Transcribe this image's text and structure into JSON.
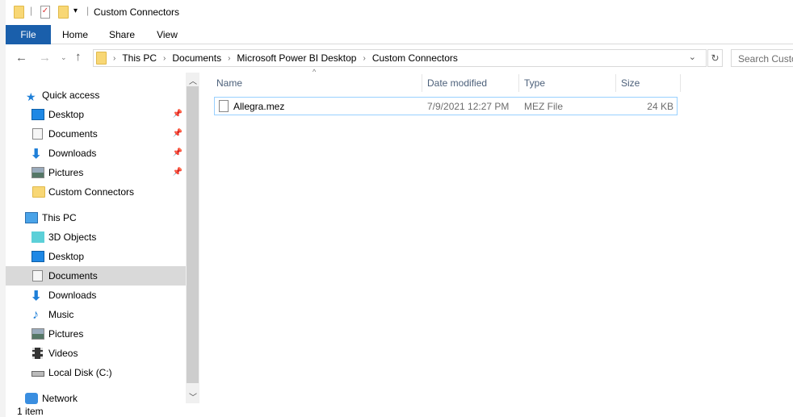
{
  "window": {
    "title": "Custom Connectors"
  },
  "ribbon": {
    "tabs": [
      "File",
      "Home",
      "Share",
      "View"
    ]
  },
  "address": {
    "crumbs": [
      "This PC",
      "Documents",
      "Microsoft Power BI Desktop",
      "Custom Connectors"
    ],
    "search_placeholder": "Search Custom Connectors"
  },
  "nav": {
    "quick_access": "Quick access",
    "quick_items": [
      {
        "label": "Desktop",
        "icon": "desktop-icon",
        "pinned": true
      },
      {
        "label": "Documents",
        "icon": "documents-icon",
        "pinned": true
      },
      {
        "label": "Downloads",
        "icon": "downloads-icon",
        "pinned": true
      },
      {
        "label": "Pictures",
        "icon": "pictures-icon",
        "pinned": true
      },
      {
        "label": "Custom Connectors",
        "icon": "folder-icon",
        "pinned": false
      }
    ],
    "this_pc": "This PC",
    "pc_items": [
      {
        "label": "3D Objects"
      },
      {
        "label": "Desktop"
      },
      {
        "label": "Documents",
        "selected": true
      },
      {
        "label": "Downloads"
      },
      {
        "label": "Music"
      },
      {
        "label": "Pictures"
      },
      {
        "label": "Videos"
      },
      {
        "label": "Local Disk (C:)"
      }
    ],
    "network": "Network"
  },
  "columns": [
    "Name",
    "Date modified",
    "Type",
    "Size"
  ],
  "files": [
    {
      "name": "Allegra.mez",
      "modified": "7/9/2021 12:27 PM",
      "type": "MEZ File",
      "size": "24 KB"
    }
  ],
  "status": {
    "count": "1 item"
  },
  "colors": {
    "file_tab": "#1a5fab",
    "selection": "#d9d9d9",
    "header_text": "#4c607a"
  }
}
